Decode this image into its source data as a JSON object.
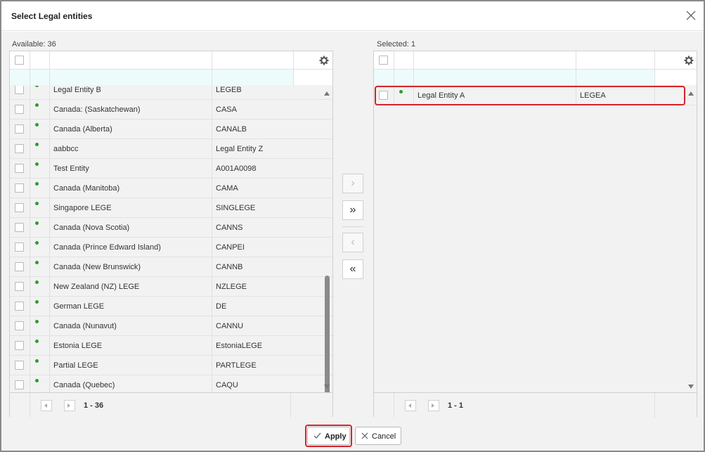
{
  "dialog": {
    "title": "Select Legal entities"
  },
  "available": {
    "label": "Available: 36",
    "rows": [
      {
        "name": "Legal Entity B",
        "code": "LEGEB"
      },
      {
        "name": "Canada: (Saskatchewan)",
        "code": "CASA"
      },
      {
        "name": "Canada (Alberta)",
        "code": "CANALB"
      },
      {
        "name": "aabbcc",
        "code": "Legal Entity Z"
      },
      {
        "name": "Test Entity",
        "code": "A001A0098"
      },
      {
        "name": "Canada (Manitoba)",
        "code": "CAMA"
      },
      {
        "name": "Singapore LEGE",
        "code": "SINGLEGE"
      },
      {
        "name": "Canada (Nova Scotia)",
        "code": "CANNS"
      },
      {
        "name": "Canada (Prince Edward Island)",
        "code": "CANPEI"
      },
      {
        "name": "Canada (New Brunswick)",
        "code": "CANNB"
      },
      {
        "name": "New Zealand (NZ) LEGE",
        "code": "NZLEGE"
      },
      {
        "name": "German LEGE",
        "code": "DE"
      },
      {
        "name": "Canada (Nunavut)",
        "code": "CANNU"
      },
      {
        "name": "Estonia LEGE",
        "code": "EstoniaLEGE"
      },
      {
        "name": "Partial LEGE",
        "code": "PARTLEGE"
      },
      {
        "name": "Canada (Quebec)",
        "code": "CAQU"
      }
    ],
    "pager": "1 - 36"
  },
  "selected": {
    "label": "Selected: 1",
    "rows": [
      {
        "name": "Legal Entity A",
        "code": "LEGEA"
      }
    ],
    "pager": "1 - 1"
  },
  "move_buttons": {
    "move_right": "›",
    "move_all_right": "»",
    "move_left": "‹",
    "move_all_left": "«"
  },
  "footer": {
    "apply_label": "Apply",
    "cancel_label": "Cancel"
  },
  "colors": {
    "status_dot": "#2e9d2e",
    "highlight": "#d8232a",
    "filter_bg": "#eefbfd"
  },
  "icons": {
    "close": "close-icon",
    "settings": "gear-icon",
    "apply": "checkmark-icon",
    "cancel": "x-icon"
  }
}
